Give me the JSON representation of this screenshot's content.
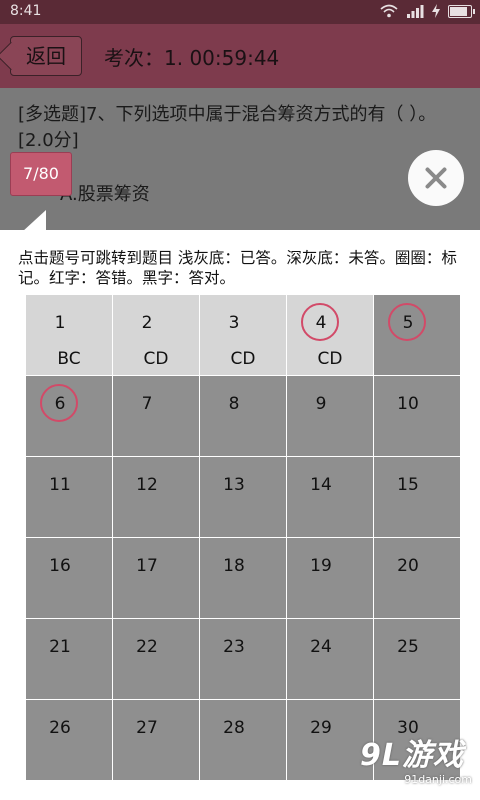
{
  "status_bar": {
    "time": "8:41"
  },
  "header": {
    "back_label": "返回",
    "exam_info": "考次：1. 00:59:44"
  },
  "question": {
    "text": "[多选题]7、下列选项中属于混合筹资方式的有（ ）。 [2.0分]",
    "option_a": "A.股票筹资"
  },
  "progress": "7/80",
  "panel": {
    "hint": "点击题号可跳转到题目 浅灰底：已答。深灰底：未答。圈圈：标记。红字：答错。黑字：答对。",
    "cells": [
      {
        "num": "1",
        "answer": "BC",
        "answered": true,
        "marked": false
      },
      {
        "num": "2",
        "answer": "CD",
        "answered": true,
        "marked": false
      },
      {
        "num": "3",
        "answer": "CD",
        "answered": true,
        "marked": false
      },
      {
        "num": "4",
        "answer": "CD",
        "answered": true,
        "marked": true
      },
      {
        "num": "5",
        "answer": "",
        "answered": false,
        "marked": true
      },
      {
        "num": "6",
        "answer": "",
        "answered": false,
        "marked": true
      },
      {
        "num": "7",
        "answer": "",
        "answered": false,
        "marked": false
      },
      {
        "num": "8",
        "answer": "",
        "answered": false,
        "marked": false
      },
      {
        "num": "9",
        "answer": "",
        "answered": false,
        "marked": false
      },
      {
        "num": "10",
        "answer": "",
        "answered": false,
        "marked": false
      },
      {
        "num": "11",
        "answer": "",
        "answered": false,
        "marked": false
      },
      {
        "num": "12",
        "answer": "",
        "answered": false,
        "marked": false
      },
      {
        "num": "13",
        "answer": "",
        "answered": false,
        "marked": false
      },
      {
        "num": "14",
        "answer": "",
        "answered": false,
        "marked": false
      },
      {
        "num": "15",
        "answer": "",
        "answered": false,
        "marked": false
      },
      {
        "num": "16",
        "answer": "",
        "answered": false,
        "marked": false
      },
      {
        "num": "17",
        "answer": "",
        "answered": false,
        "marked": false
      },
      {
        "num": "18",
        "answer": "",
        "answered": false,
        "marked": false
      },
      {
        "num": "19",
        "answer": "",
        "answered": false,
        "marked": false
      },
      {
        "num": "20",
        "answer": "",
        "answered": false,
        "marked": false
      },
      {
        "num": "21",
        "answer": "",
        "answered": false,
        "marked": false
      },
      {
        "num": "22",
        "answer": "",
        "answered": false,
        "marked": false
      },
      {
        "num": "23",
        "answer": "",
        "answered": false,
        "marked": false
      },
      {
        "num": "24",
        "answer": "",
        "answered": false,
        "marked": false
      },
      {
        "num": "25",
        "answer": "",
        "answered": false,
        "marked": false
      },
      {
        "num": "26",
        "answer": "",
        "answered": false,
        "marked": false
      },
      {
        "num": "27",
        "answer": "",
        "answered": false,
        "marked": false
      },
      {
        "num": "28",
        "answer": "",
        "answered": false,
        "marked": false
      },
      {
        "num": "29",
        "answer": "",
        "answered": false,
        "marked": false
      },
      {
        "num": "30",
        "answer": "",
        "answered": false,
        "marked": false
      }
    ]
  },
  "watermark": {
    "logo": "9L游戏",
    "url": "91danji.com"
  }
}
